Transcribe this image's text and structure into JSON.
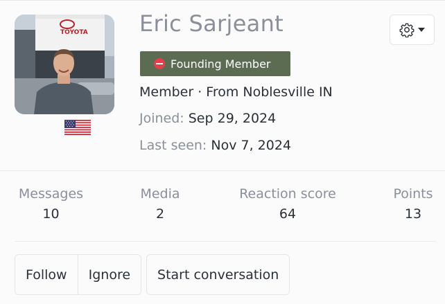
{
  "profile": {
    "name": "Eric Sarjeant",
    "badge": "Founding Member",
    "role_location": "Member · From Noblesville IN",
    "joined_label": "Joined:",
    "joined_value": "Sep 29, 2024",
    "last_seen_label": "Last seen:",
    "last_seen_value": "Nov 7, 2024",
    "avatar_icon": "user-photo",
    "flag_icon": "us-flag-icon",
    "badge_color": "#5b6c52"
  },
  "stats": [
    {
      "label": "Messages",
      "value": "10"
    },
    {
      "label": "Media",
      "value": "2"
    },
    {
      "label": "Reaction score",
      "value": "64"
    },
    {
      "label": "Points",
      "value": "13"
    }
  ],
  "actions": {
    "follow": "Follow",
    "ignore": "Ignore",
    "start_conversation": "Start conversation"
  },
  "menu": {
    "icon": "gear-icon"
  }
}
